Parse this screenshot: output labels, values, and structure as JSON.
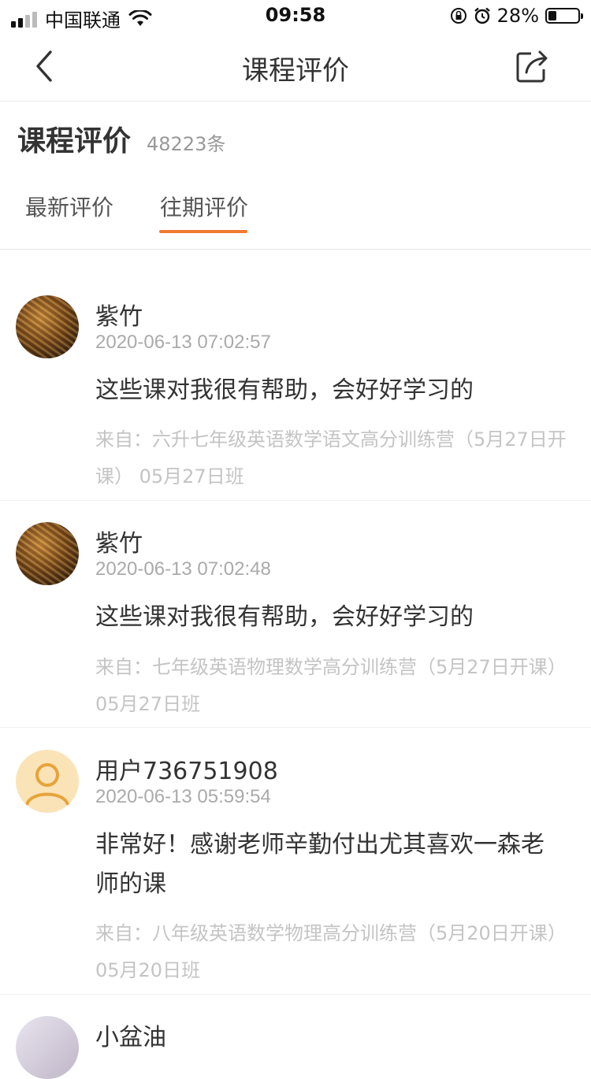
{
  "status_bar": {
    "carrier": "中国联通",
    "time": "09:58",
    "battery": "28%",
    "battery_level": 0.28,
    "signal_bars": 4,
    "signal_active": 2
  },
  "nav": {
    "title": "课程评价"
  },
  "section": {
    "title": "课程评价",
    "count": "48223条"
  },
  "tabs": {
    "latest": "最新评价",
    "past": "往期评价",
    "active": "past"
  },
  "colors": {
    "accent": "#f07a30",
    "muted": "#aaaaaa"
  },
  "reviews": [
    {
      "name": "紫竹",
      "time": "2020-06-13 07:02:57",
      "text": "这些课对我很有帮助，会好好学习的",
      "from": "来自：六升七年级英语数学语文高分训练营（5月27日开课） 05月27日班",
      "avatar": "photo"
    },
    {
      "name": "紫竹",
      "time": "2020-06-13 07:02:48",
      "text": "这些课对我很有帮助，会好好学习的",
      "from": "来自：七年级英语物理数学高分训练营（5月27日开课） 05月27日班",
      "avatar": "photo"
    },
    {
      "name": "用户736751908",
      "time": "2020-06-13 05:59:54",
      "text": "非常好！感谢老师辛勤付出尤其喜欢一森老师的课",
      "from": "来自：八年级英语数学物理高分训练营（5月20日开课） 05月20日班",
      "avatar": "default"
    },
    {
      "name": "小盆油",
      "avatar": "anime"
    }
  ]
}
